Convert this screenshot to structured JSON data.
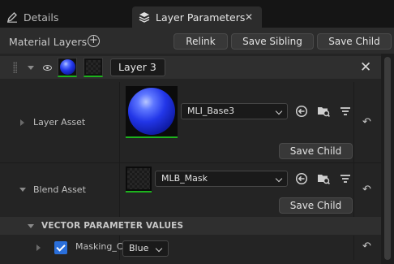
{
  "tabs": [
    {
      "label": "Details",
      "icon": "pencil-icon"
    },
    {
      "label": "Layer Parameters",
      "icon": "layers-icon",
      "close": "✕"
    }
  ],
  "toolbar": {
    "title": "Material Layers",
    "add_icon": "plus-circle-icon",
    "relink_label": "Relink",
    "save_sibling_label": "Save Sibling",
    "save_child_label": "Save Child"
  },
  "layer": {
    "name": "Layer 3",
    "close": "✕"
  },
  "layer_asset": {
    "label": "Layer Asset",
    "value": "MLI_Base3",
    "save_child_label": "Save Child"
  },
  "blend_asset": {
    "label": "Blend Asset",
    "value": "MLB_Mask",
    "save_child_label": "Save Child"
  },
  "vector_section": {
    "label": "VECTOR PARAMETER VALUES"
  },
  "param": {
    "name": "Masking_C",
    "value": "Blue",
    "checked": true
  },
  "icons": {
    "reset": "↶"
  },
  "colors": {
    "accent_blue": "#2a6fdb",
    "asset_valid_green": "#1db31d",
    "panel_bg": "#242424"
  }
}
